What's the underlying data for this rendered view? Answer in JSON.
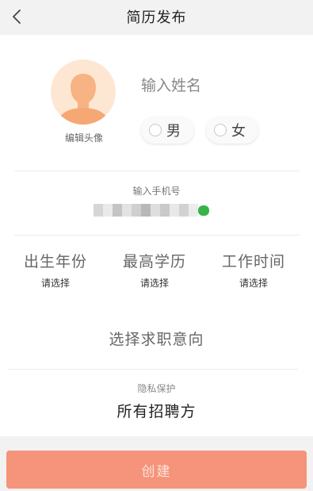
{
  "header": {
    "title": "简历发布"
  },
  "profile": {
    "avatar_label": "编辑头像",
    "name_placeholder": "输入姓名",
    "gender_options": [
      "男",
      "女"
    ]
  },
  "phone": {
    "label": "输入手机号"
  },
  "details": [
    {
      "title": "出生年份",
      "value": "请选择"
    },
    {
      "title": "最高学历",
      "value": "请选择"
    },
    {
      "title": "工作时间",
      "value": "请选择"
    }
  ],
  "job_intent": {
    "label": "选择求职意向"
  },
  "privacy": {
    "label": "隐私保护",
    "value": "所有招聘方"
  },
  "footer": {
    "create_label": "创建"
  },
  "colors": {
    "accent": "#f5947a",
    "avatar_bg": "#fde2c9",
    "page_bg": "#f2f2f2"
  }
}
